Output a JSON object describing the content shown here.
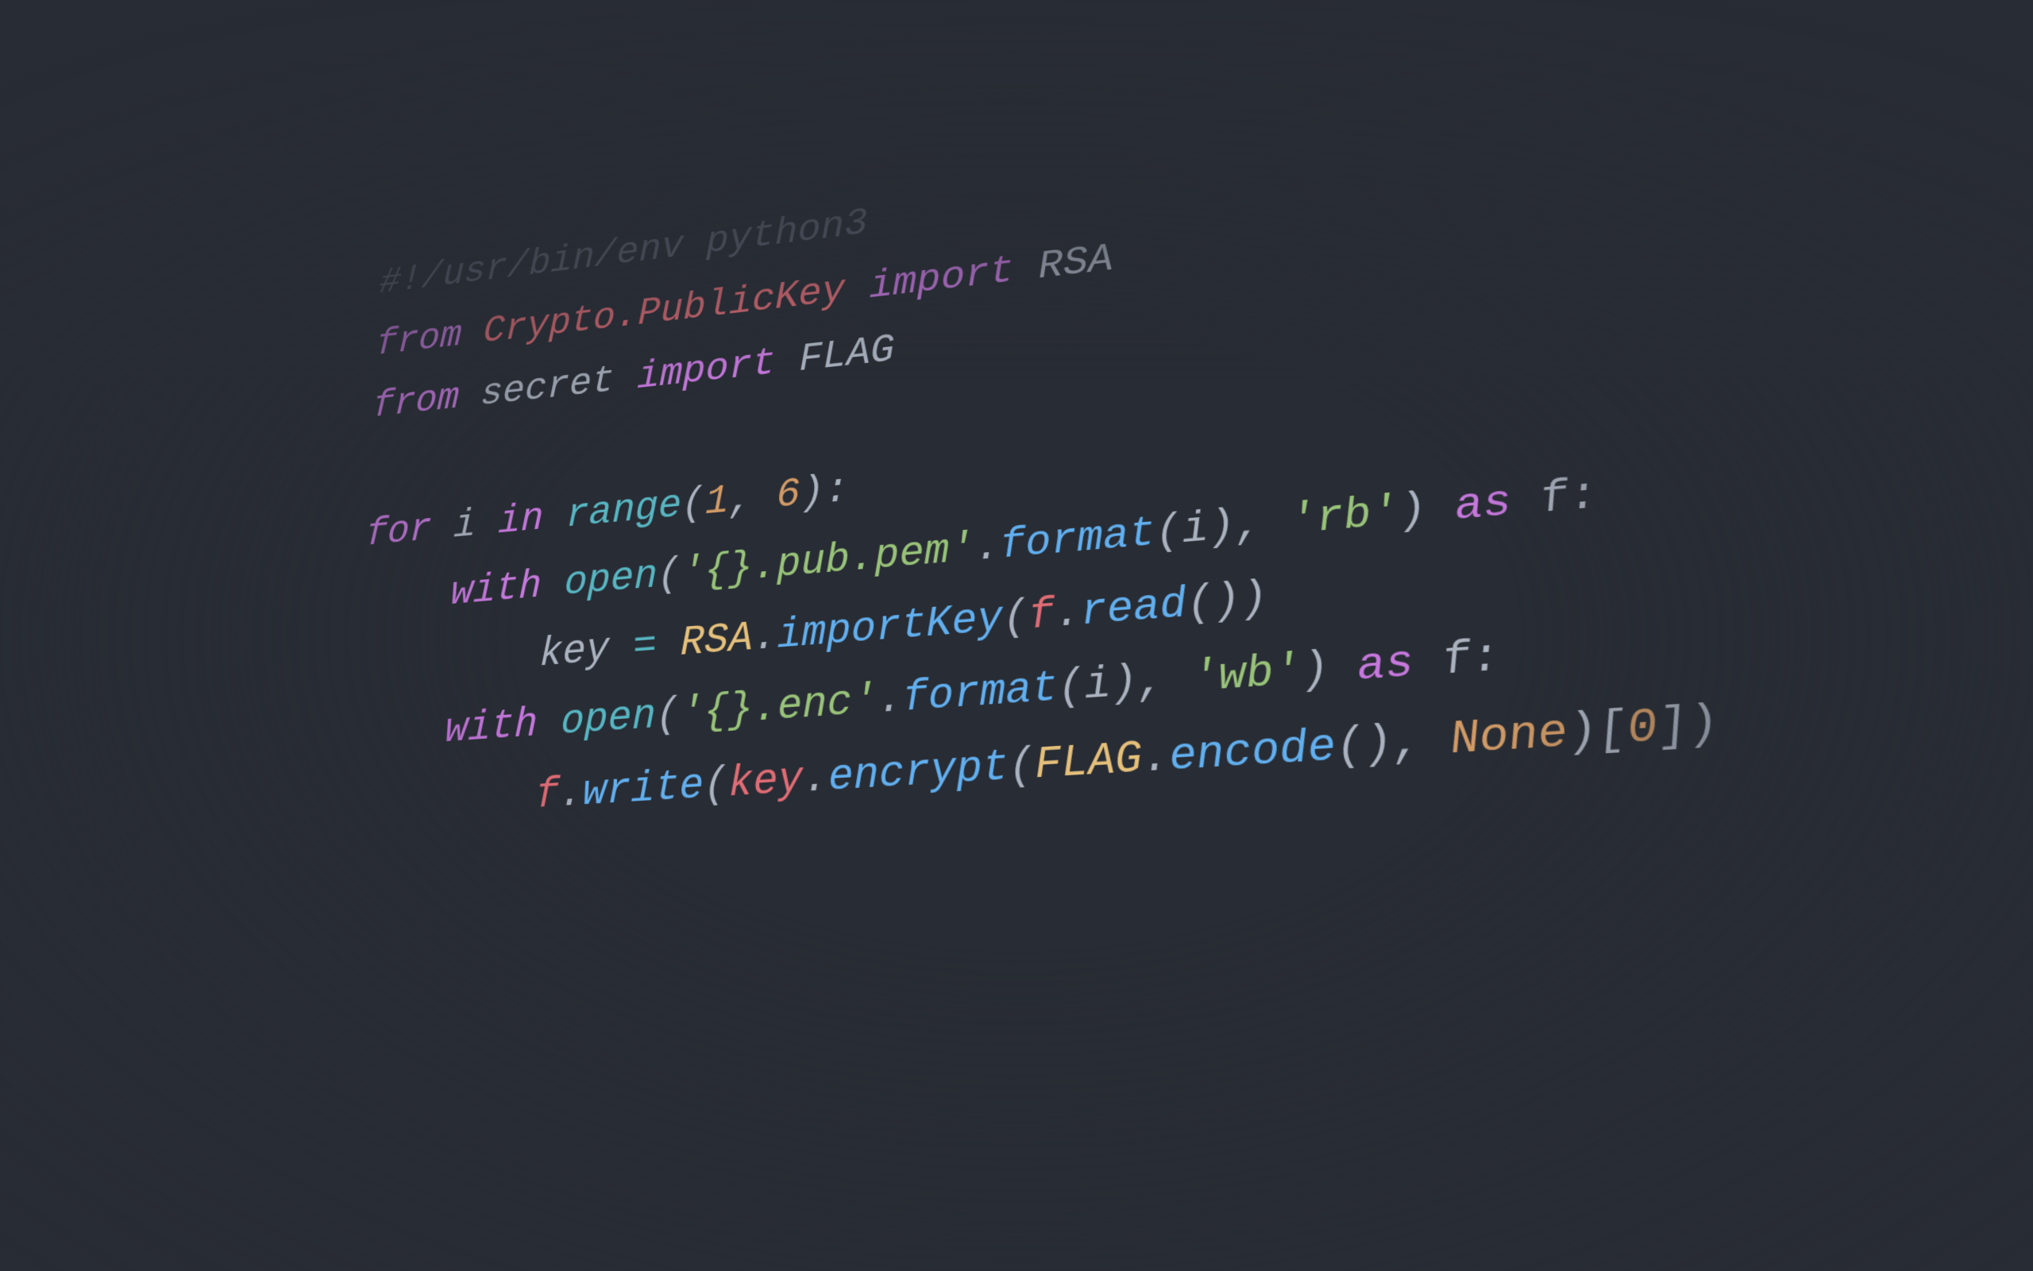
{
  "code": {
    "line1": {
      "shebang": "#!/usr/bin/env python3"
    },
    "line2": {
      "from": "from",
      "mod": "Crypto.PublicKey",
      "import": "import",
      "name": "RSA"
    },
    "line3": {
      "from": "from",
      "mod": "secret",
      "import": "import",
      "name": "FLAG"
    },
    "line5": {
      "for": "for",
      "var": "i",
      "in": "in",
      "range": "range",
      "lp": "(",
      "a": "1",
      "comma": ", ",
      "b": "6",
      "rp": ")",
      "colon": ":"
    },
    "line6": {
      "with": "with",
      "open": "open",
      "lp": "(",
      "s1": "'{}.pub.pem'",
      "dot": ".",
      "format": "format",
      "lp2": "(",
      "arg": "i",
      "rp2": ")",
      "comma": ", ",
      "s2": "'rb'",
      "rp": ")",
      "as": "as",
      "f": "f",
      "colon": ":"
    },
    "line7": {
      "key": "key",
      "eq": " = ",
      "rsa": "RSA",
      "dot1": ".",
      "importKey": "importKey",
      "lp": "(",
      "f": "f",
      "dot2": ".",
      "read": "read",
      "lp2": "(",
      "rp2": ")",
      "rp": ")"
    },
    "line8": {
      "with": "with",
      "open": "open",
      "lp": "(",
      "s1": "'{}.enc'",
      "dot": ".",
      "format": "format",
      "lp2": "(",
      "arg": "i",
      "rp2": ")",
      "comma": ", ",
      "s2": "'wb'",
      "rp": ")",
      "as": "as",
      "f": "f",
      "colon": ":"
    },
    "line9": {
      "f": "f",
      "dot1": ".",
      "write": "write",
      "lp": "(",
      "key": "key",
      "dot2": ".",
      "encrypt": "encrypt",
      "lp2": "(",
      "flag": "FLAG",
      "dot3": ".",
      "encode": "encode",
      "lp3": "(",
      "rp3": ")",
      "comma": ", ",
      "none": "None",
      "rp2": ")",
      "lb": "[",
      "idx": "0",
      "rb": "]",
      "rp": ")"
    }
  }
}
